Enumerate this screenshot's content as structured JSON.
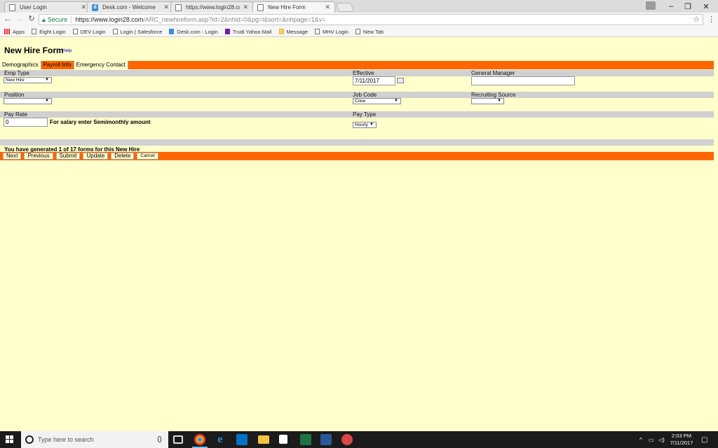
{
  "browser": {
    "tabs": [
      {
        "label": "User Login",
        "icon": "page-icon"
      },
      {
        "label": "Desk.com - Welcome",
        "icon": "desk-icon"
      },
      {
        "label": "https://www.login28.com",
        "icon": "page-icon"
      },
      {
        "label": "New Hire Form",
        "icon": "page-icon"
      }
    ],
    "secure_label": "Secure",
    "url_host": "https://www.login28.com",
    "url_path": "/ARC_newhireform.asp?id=2&nhid=0&pg=l&sort=&nhpage=1&v=",
    "bookmarks": [
      {
        "label": "Apps",
        "icon": "apps-icon"
      },
      {
        "label": "Eight Login",
        "icon": "page-icon"
      },
      {
        "label": "DEV Login",
        "icon": "page-icon"
      },
      {
        "label": "Login | Salesforce",
        "icon": "page-icon"
      },
      {
        "label": "Desk.com - Login",
        "icon": "desk-icon"
      },
      {
        "label": "Trudi Yahoo Mail",
        "icon": "yahoo-icon"
      },
      {
        "label": "Message",
        "icon": "message-icon"
      },
      {
        "label": "MHV Login",
        "icon": "page-icon"
      },
      {
        "label": "New Tab",
        "icon": "page-icon"
      }
    ]
  },
  "form": {
    "title": "New Hire Form",
    "help_label": "Help",
    "tabs": [
      {
        "label": "Demographics",
        "selected": false
      },
      {
        "label": "Payroll Info",
        "selected": true
      },
      {
        "label": "Emergency Contact",
        "selected": false
      }
    ],
    "fields": {
      "emp_type": {
        "label": "Emp Type",
        "value": "New Hire"
      },
      "effective": {
        "label": "Effective",
        "value": "7/11/2017"
      },
      "general_manager": {
        "label": "General Manager",
        "value": ""
      },
      "position": {
        "label": "Position",
        "value": ""
      },
      "job_code": {
        "label": "Job Code",
        "value": "Crew"
      },
      "recruiting_source": {
        "label": "Recruiting Source",
        "value": ""
      },
      "pay_rate": {
        "label": "Pay Rate",
        "value": "0",
        "note": "For salary enter Semimonthly amount"
      },
      "pay_type": {
        "label": "Pay Type",
        "value": "Hourly"
      }
    },
    "generated_text": "You have generated 1 of 17 forms for this New Hire",
    "buttons": {
      "next": "Next",
      "previous": "Previous",
      "submit": "Submit",
      "update": "Update",
      "delete": "Delete",
      "cancel": "Cancel"
    }
  },
  "taskbar": {
    "search_placeholder": "Type here to search",
    "time": "2:03 PM",
    "date": "7/11/2017"
  },
  "colors": {
    "page_bg": "#ffffcc",
    "accent": "#ff6600",
    "header_gray": "#d0d0d0"
  }
}
